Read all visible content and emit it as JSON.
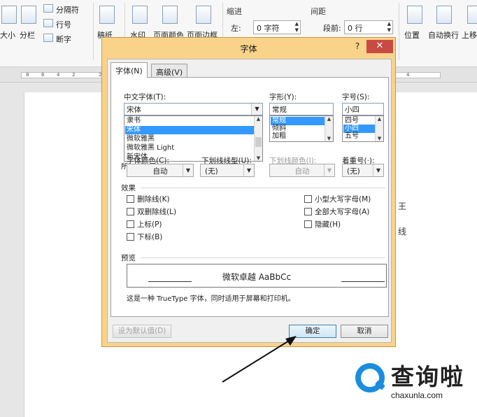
{
  "ribbon": {
    "size_label": "大小",
    "columns_label": "分栏",
    "breaks_label": "分隔符",
    "line_numbers_label": "行号",
    "hyphenation_label": "断字",
    "manuscript_label": "稿纸",
    "watermark_label": "水印",
    "page_color_label": "页面颜色",
    "page_border_label": "页面边框",
    "indent_group_label": "缩进",
    "spacing_group_label": "间距",
    "indent_left_label": "左:",
    "indent_left_value": "0 字符",
    "spacing_before_label": "段前:",
    "spacing_before_value": "0 行",
    "position_label": "位置",
    "wrap_text_label": "自动换行",
    "bring_forward_label": "上移"
  },
  "ruler": {
    "ticks": [
      "8",
      "6",
      "4",
      "2",
      "2",
      "4"
    ]
  },
  "doc_fragments": [
    "王",
    "线"
  ],
  "dialog": {
    "title": "字体",
    "help": "?",
    "close": "✕",
    "tabs": [
      {
        "label": "字体(N)",
        "active": true
      },
      {
        "label": "高级(V)",
        "active": false
      }
    ],
    "chinese_font": {
      "label": "中文字体(T):",
      "value": "宋体",
      "options": [
        "隶书",
        "宋体",
        "微软雅黑",
        "微软雅黑 Light",
        "新宋体"
      ],
      "selected": "宋体"
    },
    "western_font_partial_label": "所",
    "font_style": {
      "label": "字形(Y):",
      "value": "常规",
      "options": [
        "常规",
        "倾斜",
        "加粗"
      ],
      "selected": "常规"
    },
    "font_size": {
      "label": "字号(S):",
      "value": "小四",
      "options": [
        "四号",
        "小四",
        "五号"
      ],
      "selected": "小四"
    },
    "font_color": {
      "label": "字体颜色(C):",
      "value": "自动"
    },
    "underline_style": {
      "label": "下划线线型(U):",
      "value": "(无)"
    },
    "underline_color": {
      "label": "下划线颜色(I):",
      "value": "自动"
    },
    "emphasis_mark": {
      "label": "着重号(·):",
      "value": "(无)"
    },
    "effects": {
      "label": "效果",
      "left": [
        {
          "label": "删除线(K)",
          "checked": false
        },
        {
          "label": "双删除线(L)",
          "checked": false
        },
        {
          "label": "上标(P)",
          "checked": false
        },
        {
          "label": "下标(B)",
          "checked": false
        }
      ],
      "right": [
        {
          "label": "小型大写字母(M)",
          "checked": false
        },
        {
          "label": "全部大写字母(A)",
          "checked": false
        },
        {
          "label": "隐藏(H)",
          "checked": false
        }
      ]
    },
    "preview": {
      "label": "预览",
      "text": "微软卓越 AaBbCc",
      "note": "这是一种 TrueType 字体，同时适用于屏幕和打印机。"
    },
    "buttons": {
      "set_default": "设为默认值(D)",
      "ok": "确定",
      "cancel": "取消"
    }
  },
  "watermark": {
    "title": "查询啦",
    "url": "chaxunla.com",
    "color": "#1a8de0"
  }
}
